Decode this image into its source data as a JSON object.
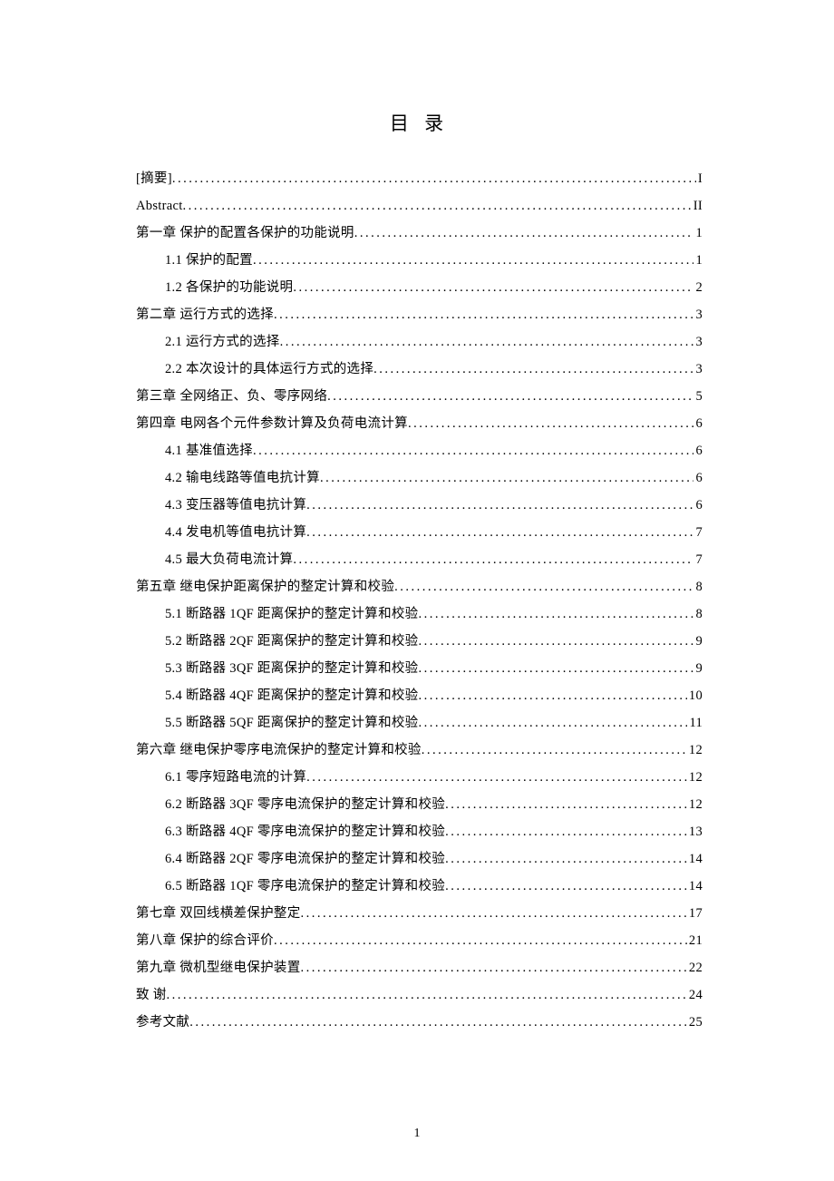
{
  "title": "目 录",
  "footer_page": "1",
  "toc": [
    {
      "level": 0,
      "label": "[摘要]",
      "page": "I"
    },
    {
      "level": 0,
      "label": "Abstract",
      "page": "II"
    },
    {
      "level": 0,
      "label": "第一章 保护的配置各保护的功能说明",
      "page": "1"
    },
    {
      "level": 1,
      "label": "1.1 保护的配置",
      "page": "1"
    },
    {
      "level": 1,
      "label": "1.2 各保护的功能说明",
      "page": "2"
    },
    {
      "level": 0,
      "label": "第二章  运行方式的选择",
      "page": "3"
    },
    {
      "level": 1,
      "label": "2.1 运行方式的选择",
      "page": "3"
    },
    {
      "level": 1,
      "label": "2.2 本次设计的具体运行方式的选择",
      "page": "3"
    },
    {
      "level": 0,
      "label": "第三章  全网络正、负、零序网络",
      "page": "5"
    },
    {
      "level": 0,
      "label": "第四章  电网各个元件参数计算及负荷电流计算",
      "page": "6"
    },
    {
      "level": 1,
      "label": "4.1 基准值选择",
      "page": "6"
    },
    {
      "level": 1,
      "label": "4.2 输电线路等值电抗计算",
      "page": "6"
    },
    {
      "level": 1,
      "label": "4.3 变压器等值电抗计算",
      "page": "6"
    },
    {
      "level": 1,
      "label": "4.4 发电机等值电抗计算",
      "page": "7"
    },
    {
      "level": 1,
      "label": "4.5 最大负荷电流计算",
      "page": "7"
    },
    {
      "level": 0,
      "label": "第五章 继电保护距离保护的整定计算和校验",
      "page": "8"
    },
    {
      "level": 1,
      "label": "5.1 断路器 1QF 距离保护的整定计算和校验",
      "page": "8"
    },
    {
      "level": 1,
      "label": "5.2 断路器 2QF 距离保护的整定计算和校验",
      "page": "9"
    },
    {
      "level": 1,
      "label": "5.3 断路器 3QF 距离保护的整定计算和校验",
      "page": "9"
    },
    {
      "level": 1,
      "label": "5.4 断路器 4QF 距离保护的整定计算和校验",
      "page": "10"
    },
    {
      "level": 1,
      "label": "5.5 断路器 5QF 距离保护的整定计算和校验",
      "page": "11"
    },
    {
      "level": 0,
      "label": "第六章 继电保护零序电流保护的整定计算和校验",
      "page": "12"
    },
    {
      "level": 1,
      "label": "6.1 零序短路电流的计算",
      "page": "12"
    },
    {
      "level": 1,
      "label": "6.2 断路器 3QF 零序电流保护的整定计算和校验",
      "page": "12"
    },
    {
      "level": 1,
      "label": "6.3 断路器 4QF 零序电流保护的整定计算和校验",
      "page": "13"
    },
    {
      "level": 1,
      "label": "6.4 断路器 2QF 零序电流保护的整定计算和校验",
      "page": "14"
    },
    {
      "level": 1,
      "label": "6.5 断路器 1QF 零序电流保护的整定计算和校验",
      "page": "14"
    },
    {
      "level": 0,
      "label": "第七章 双回线横差保护整定",
      "page": "17"
    },
    {
      "level": 0,
      "label": "第八章  保护的综合评价",
      "page": "21"
    },
    {
      "level": 0,
      "label": "第九章 微机型继电保护装置",
      "page": "22"
    },
    {
      "level": 0,
      "label": "致  谢",
      "page": "24"
    },
    {
      "level": 0,
      "label": "参考文献",
      "page": "25"
    }
  ]
}
